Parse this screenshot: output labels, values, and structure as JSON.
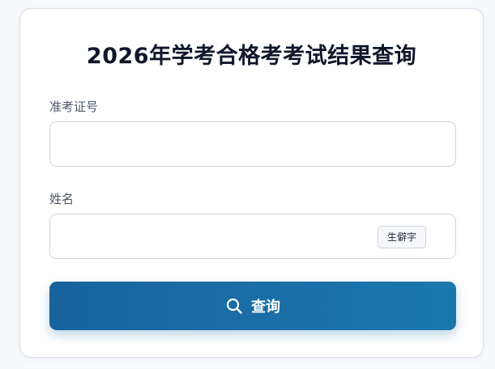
{
  "form": {
    "title": "2026年学考合格考考试结果查询",
    "exam_id_label": "准考证号",
    "exam_id_value": "",
    "name_label": "姓名",
    "name_value": "",
    "rare_char_button": "生僻字",
    "submit_label": "查询",
    "submit_icon": "search-icon"
  },
  "colors": {
    "button_gradient_start": "#19639e",
    "button_gradient_end": "#1b78ad",
    "title": "#0f172a",
    "label": "#4b5563"
  }
}
